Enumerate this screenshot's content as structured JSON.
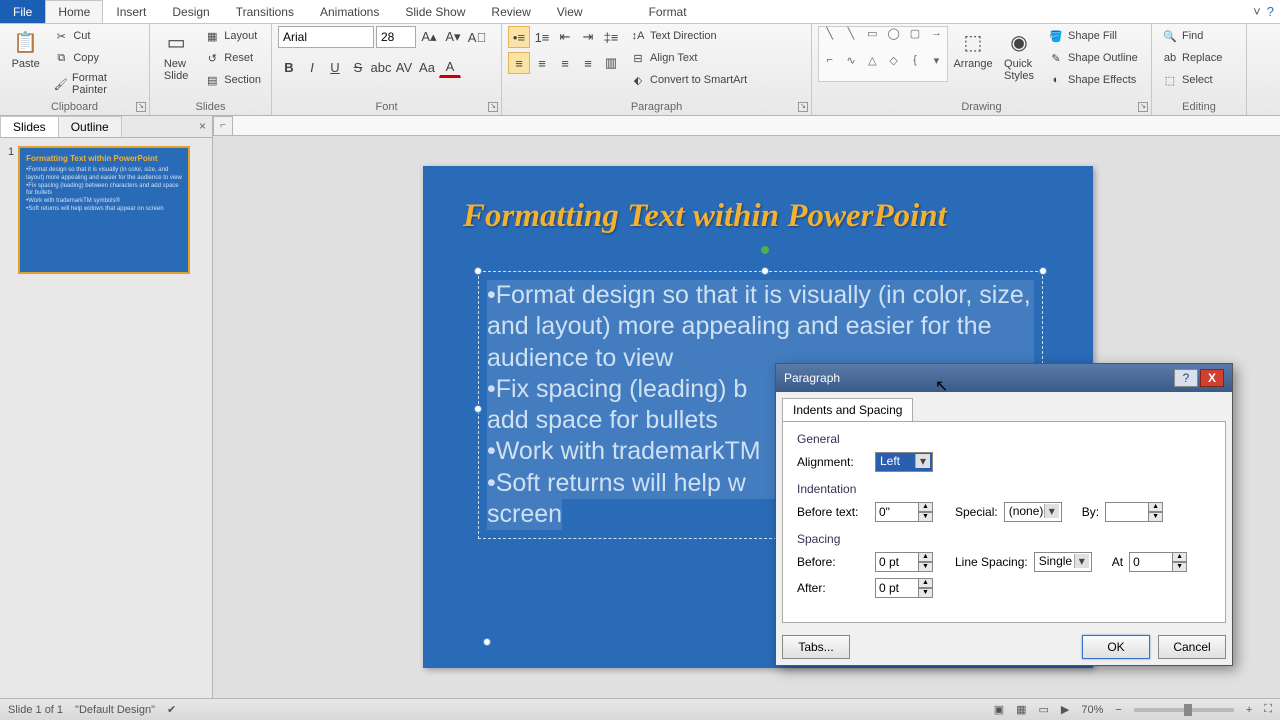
{
  "tabs": {
    "file": "File",
    "home": "Home",
    "insert": "Insert",
    "design": "Design",
    "transitions": "Transitions",
    "animations": "Animations",
    "slideshow": "Slide Show",
    "review": "Review",
    "view": "View",
    "format": "Format"
  },
  "ribbon": {
    "clipboard": {
      "label": "Clipboard",
      "paste": "Paste",
      "cut": "Cut",
      "copy": "Copy",
      "fmtpainter": "Format Painter"
    },
    "slides": {
      "label": "Slides",
      "newslide": "New\nSlide",
      "layout": "Layout",
      "reset": "Reset",
      "section": "Section"
    },
    "font": {
      "label": "Font",
      "name": "Arial",
      "size": "28"
    },
    "paragraph": {
      "label": "Paragraph",
      "textdir": "Text Direction",
      "align": "Align Text",
      "smartart": "Convert to SmartArt"
    },
    "drawing": {
      "label": "Drawing",
      "arrange": "Arrange",
      "quick": "Quick\nStyles",
      "fill": "Shape Fill",
      "outline": "Shape Outline",
      "effects": "Shape Effects"
    },
    "editing": {
      "label": "Editing",
      "find": "Find",
      "replace": "Replace",
      "select": "Select"
    }
  },
  "side": {
    "slides": "Slides",
    "outline": "Outline",
    "num": "1"
  },
  "slide": {
    "title": "Formatting Text within PowerPoint",
    "b1": "•Format design so that it is visually (in color, size, and layout) more appealing and easier for the audience to view",
    "b2": "•Fix spacing (leading) b",
    "b2b": "add space for bullets",
    "b3": "•Work with trademarkTM",
    "b4": "•Soft returns will help w",
    "b4b": "screen"
  },
  "thumb": {
    "title": "Formatting  Text within  PowerPoint",
    "body": "•Format design so that it is visually (in color, size, and layout) more appealing and easier for the audience to view\n•Fix spacing (leading) between characters and add space for bullets\n•Work with trademarkTM symbols®\n•Soft returns will help widows that appear on screen"
  },
  "dialog": {
    "title": "Paragraph",
    "tab": "Indents and Spacing",
    "general": "General",
    "alignment": "Alignment:",
    "alignval": "Left",
    "indent": "Indentation",
    "before_text": "Before text:",
    "before_text_v": "0\"",
    "special": "Special:",
    "special_v": "(none)",
    "by": "By:",
    "by_v": "",
    "spacing": "Spacing",
    "before": "Before:",
    "before_v": "0 pt",
    "after": "After:",
    "after_v": "0 pt",
    "linesp": "Line Spacing:",
    "linesp_v": "Single",
    "at": "At",
    "at_v": "0",
    "tabs": "Tabs...",
    "ok": "OK",
    "cancel": "Cancel"
  },
  "status": {
    "slide": "Slide 1 of 1",
    "theme": "\"Default Design\"",
    "zoom": "70%"
  }
}
